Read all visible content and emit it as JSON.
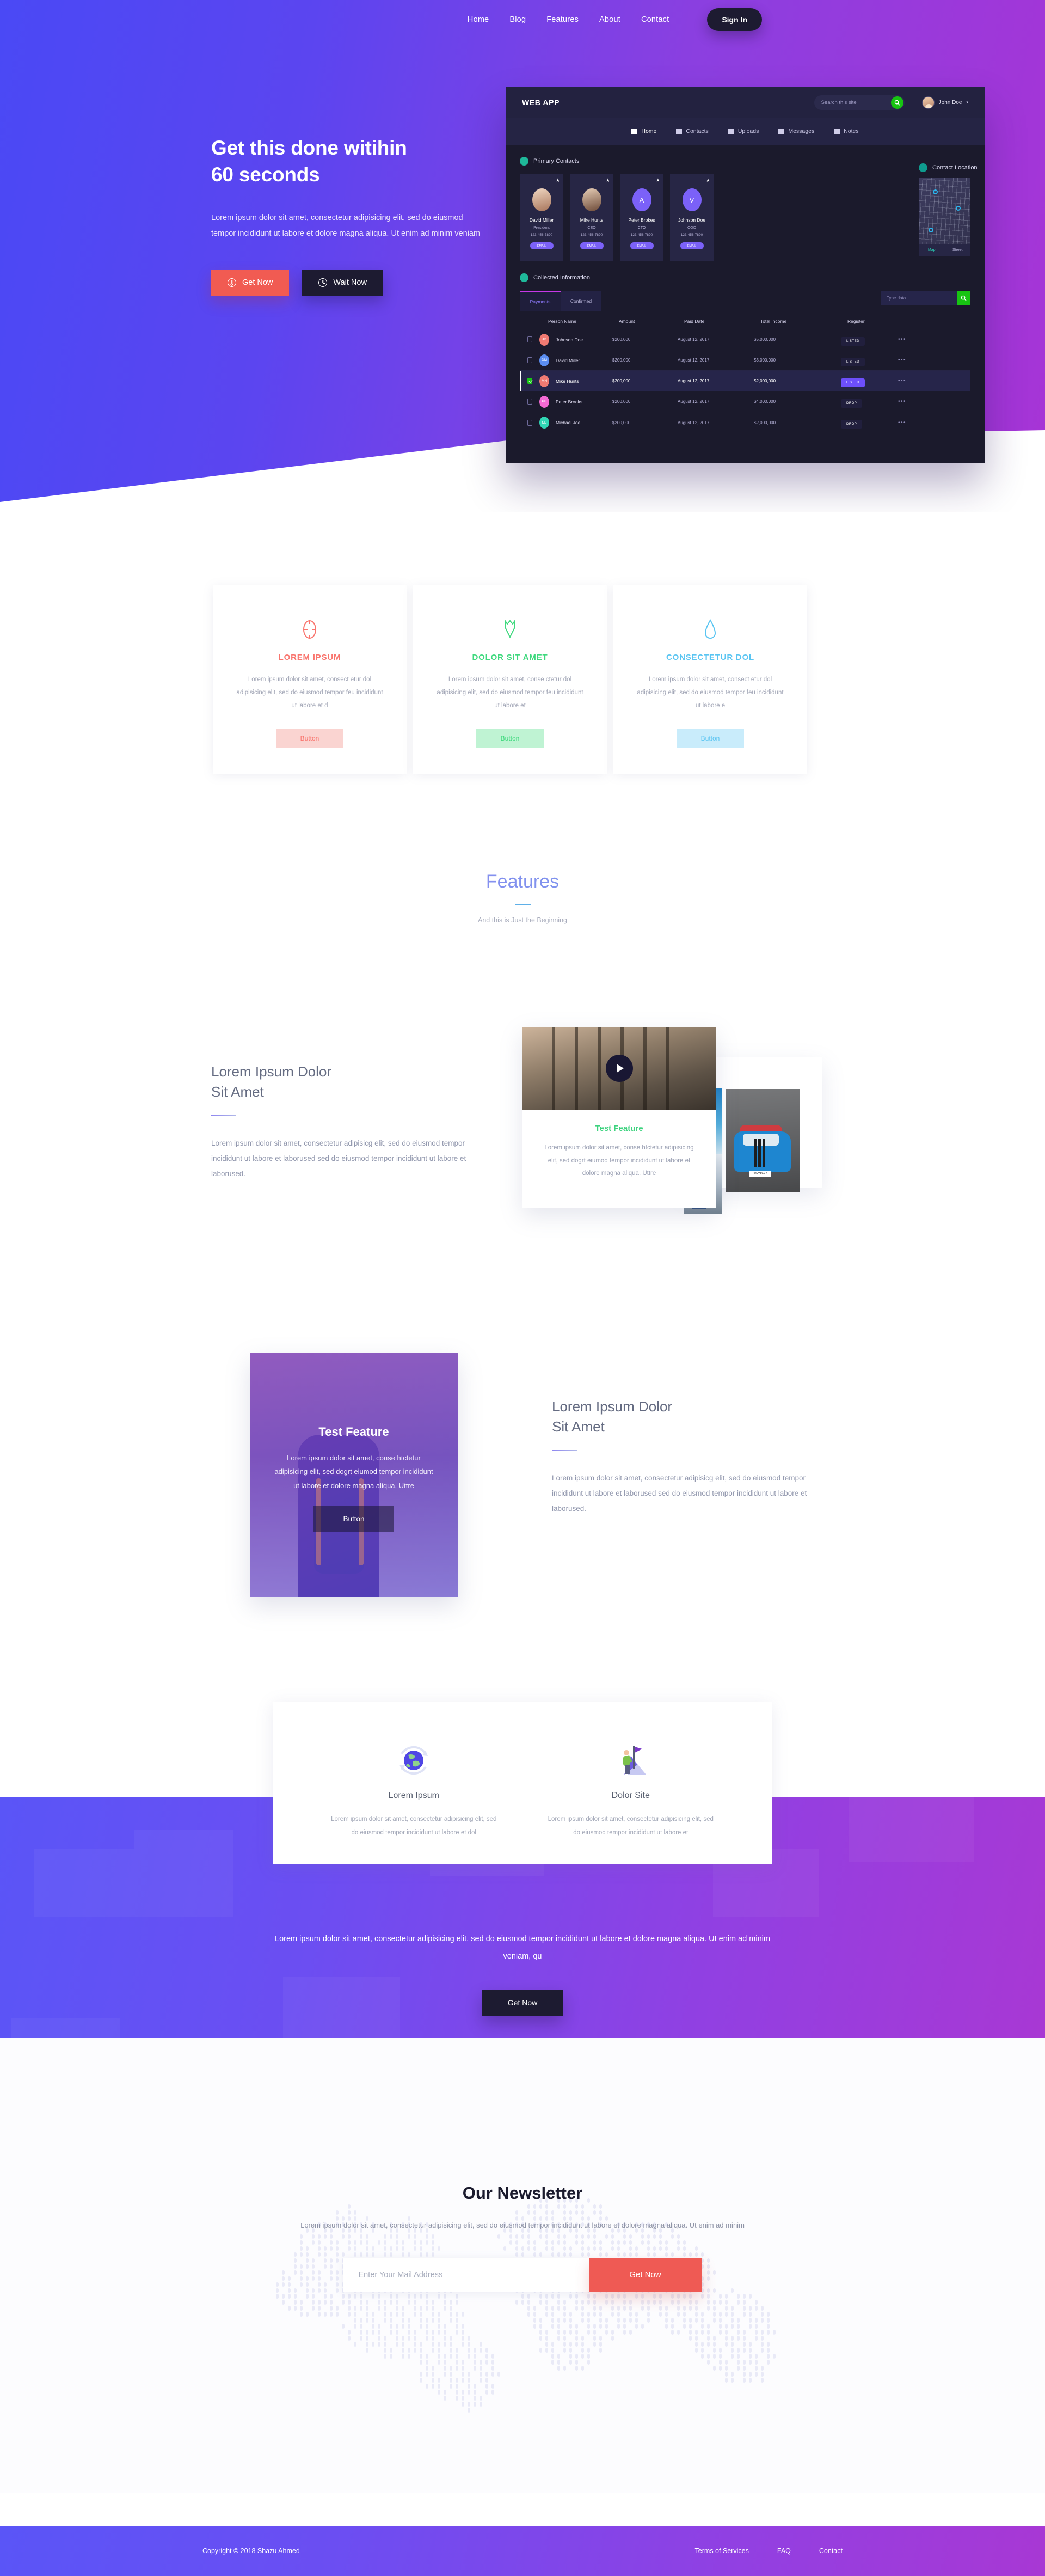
{
  "nav": {
    "links": [
      {
        "label": "Home"
      },
      {
        "label": "Blog"
      },
      {
        "label": "Features"
      },
      {
        "label": "About"
      },
      {
        "label": "Contact"
      }
    ],
    "signin_label": "Sign In"
  },
  "hero": {
    "title_line1": "Get this done witihin",
    "title_line2": "60 seconds",
    "subtitle": "Lorem ipsum dolor sit amet, consectetur adipisicing elit, sed do eiusmod tempor incididunt ut labore et dolore magna aliqua. Ut enim ad minim veniam",
    "btn_primary": "Get Now",
    "btn_secondary": "Wait Now"
  },
  "dashboard": {
    "logo": "WEB APP",
    "search_placeholder": "Search this site",
    "user_name": "John Doe",
    "nav_items": [
      {
        "label": "Home",
        "icon": "home-icon"
      },
      {
        "label": "Contacts",
        "icon": "star-icon"
      },
      {
        "label": "Uploads",
        "icon": "upload-icon"
      },
      {
        "label": "Messages",
        "icon": "envelope-icon"
      },
      {
        "label": "Notes",
        "icon": "notes-icon"
      }
    ],
    "contacts_heading": "Primary Contacts",
    "location_heading": "Contact Location",
    "contacts": [
      {
        "name": "David Miller",
        "role": "President",
        "phone": "123-456-7890",
        "email_label": "EMAIL",
        "initial": ""
      },
      {
        "name": "Mike Hunts",
        "role": "CEO",
        "phone": "123-456-7890",
        "email_label": "EMAIL",
        "initial": ""
      },
      {
        "name": "Peter Brokes",
        "role": "CTO",
        "phone": "123-456-7890",
        "email_label": "EMAIL",
        "initial": "A"
      },
      {
        "name": "Johnson Doe",
        "role": "COO",
        "phone": "123-456-7890",
        "email_label": "EMAIL",
        "initial": "V"
      }
    ],
    "map_tabs": [
      {
        "label": "Map"
      },
      {
        "label": "Street"
      }
    ],
    "table_heading": "Collected Information",
    "table_tabs": [
      {
        "label": "Payments"
      },
      {
        "label": "Confirmed"
      }
    ],
    "table_search_placeholder": "Type data",
    "table_columns": [
      "Person Name",
      "Amount",
      "Paid Date",
      "Total Income",
      "Register"
    ],
    "table_rows": [
      {
        "initials": "JD",
        "name": "Johnson Doe",
        "amount": "$200,000",
        "date": "August 12, 2017",
        "income": "$5,000,000",
        "status": "LISTED"
      },
      {
        "initials": "DM",
        "name": "David Miller",
        "amount": "$200,000",
        "date": "August 12, 2017",
        "income": "$3,000,000",
        "status": "LISTED"
      },
      {
        "initials": "MH",
        "name": "Mike Hunts",
        "amount": "$200,000",
        "date": "August 12, 2017",
        "income": "$2,000,000",
        "status": "LISTED"
      },
      {
        "initials": "PB",
        "name": "Peter Brooks",
        "amount": "$200,000",
        "date": "August 12, 2017",
        "income": "$4,000,000",
        "status": "DROP"
      },
      {
        "initials": "MJ",
        "name": "Michael Joe",
        "amount": "$200,000",
        "date": "August 12, 2017",
        "income": "$2,000,000",
        "status": "DROP"
      }
    ]
  },
  "tri_cards": [
    {
      "icon": "target-icon",
      "title": "LOREM IPSUM",
      "body": "Lorem ipsum dolor sit amet, consect etur dol adipisicing elit, sed do eiusmod tempor feu incididunt ut labore et d",
      "button": "Button",
      "color": "#f9756e",
      "button_bg": "#fad4d1"
    },
    {
      "icon": "shield-icon",
      "title": "DOLOR SIT AMET",
      "body": "Lorem ipsum dolor sit amet, conse ctetur dol adipisicing elit, sed do eiusmod tempor feu incididunt ut labore et",
      "button": "Button",
      "color": "#3fd97e",
      "button_bg": "#bff3d3"
    },
    {
      "icon": "drop-icon",
      "title": "CONSECTETUR DOL",
      "body": "Lorem ipsum dolor sit amet, consect etur dol adipisicing elit, sed do eiusmod tempor feu incididunt ut labore e",
      "button": "Button",
      "color": "#5ac5f2",
      "button_bg": "#c9ecfb"
    }
  ],
  "features": {
    "title": "Features",
    "subtitle": "And this is Just the Beginning"
  },
  "feature_block_1": {
    "heading_line1": "Lorem Ipsum Dolor",
    "heading_line2": "Sit Amet",
    "body": "Lorem ipsum dolor sit amet, consectetur adipisicg elit, sed do eiusmod tempor incididunt ut labore et laborused sed do eiusmod tempor incididunt ut labore et laborused."
  },
  "feature_card": {
    "title": "Test Feature",
    "body": "Lorem ipsum dolor sit amet, conse htctetur adipisicing elit, sed dogrt eiumod tempor incididunt ut labore et dolore magna aliqua. Uttre",
    "car_plate": "11-YD-27"
  },
  "feature_block_2": {
    "heading_line1": "Lorem Ipsum Dolor",
    "heading_line2": "Sit Amet",
    "body": "Lorem ipsum dolor sit amet, consectetur adipisicg elit, sed do eiusmod tempor incididunt ut labore et laborused sed do eiusmod tempor incididunt ut labore et laborused."
  },
  "overlay_card": {
    "title": "Test Feature",
    "body": "Lorem ipsum dolor sit amet, conse htctetur adipisicing elit, sed dogrt eiumod tempor incididunt ut labore et dolore magna aliqua. Uttre",
    "button": "Button"
  },
  "pair_cards": [
    {
      "icon": "globe-icon",
      "title": "Lorem Ipsum",
      "body": "Lorem ipsum dolor sit amet, consectetur adipisicing elit, sed do eiusmod tempor incididunt ut labore et dol"
    },
    {
      "icon": "flag-mountain-icon",
      "title": "Dolor Site",
      "body": "Lorem ipsum dolor sit amet, consectetur adipisicing elit, sed do eiusmod tempor incididunt ut labore et"
    }
  ],
  "cta": {
    "text": "Lorem ipsum dolor sit amet, consectetur adipisicing elit, sed do eiusmod tempor incididunt ut labore et dolore magna aliqua. Ut enim ad minim veniam, qu",
    "button": "Get Now"
  },
  "newsletter": {
    "title": "Our Newsletter",
    "body": "Lorem ipsum dolor sit amet, consectetur adipisicing elit, sed do eiusmod tempor incididunt ut labore et dolore magna aliqua. Ut enim ad minim",
    "input_placeholder": "Enter Your Mail Address",
    "button": "Get Now"
  },
  "footer": {
    "copyright": "Copyright © 2018 Shazu Ahmed",
    "links": [
      {
        "label": "Terms of Services"
      },
      {
        "label": "FAQ"
      },
      {
        "label": "Contact"
      }
    ]
  }
}
